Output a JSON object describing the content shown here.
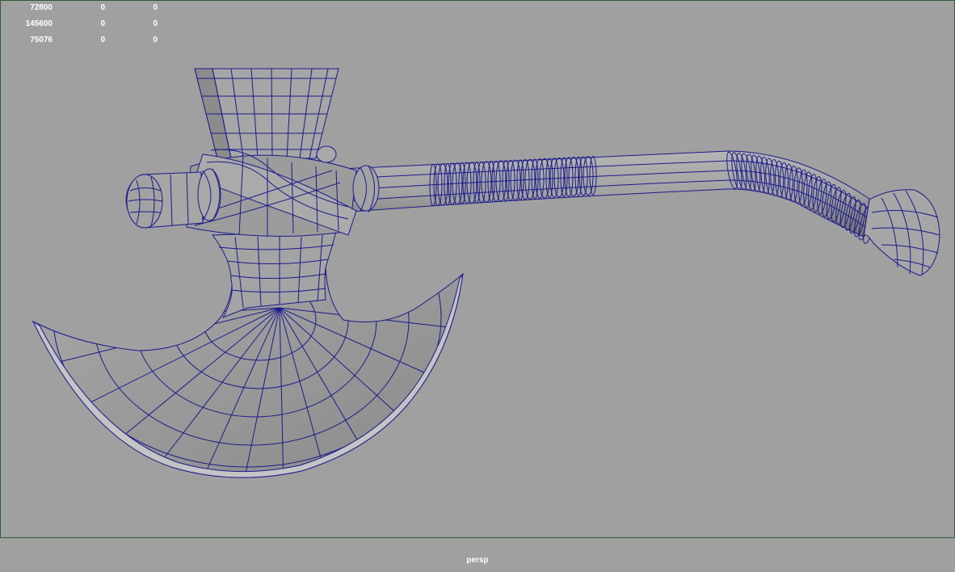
{
  "hud": {
    "rows": [
      [
        "72800",
        "0",
        "0"
      ],
      [
        "145600",
        "0",
        "0"
      ],
      [
        "75076",
        "0",
        "0"
      ]
    ]
  },
  "viewport": {
    "camera": "persp",
    "background_color": "#a0a0a0",
    "wire_color": "#1a1a8c",
    "surface_color": "#9a9a9a"
  }
}
